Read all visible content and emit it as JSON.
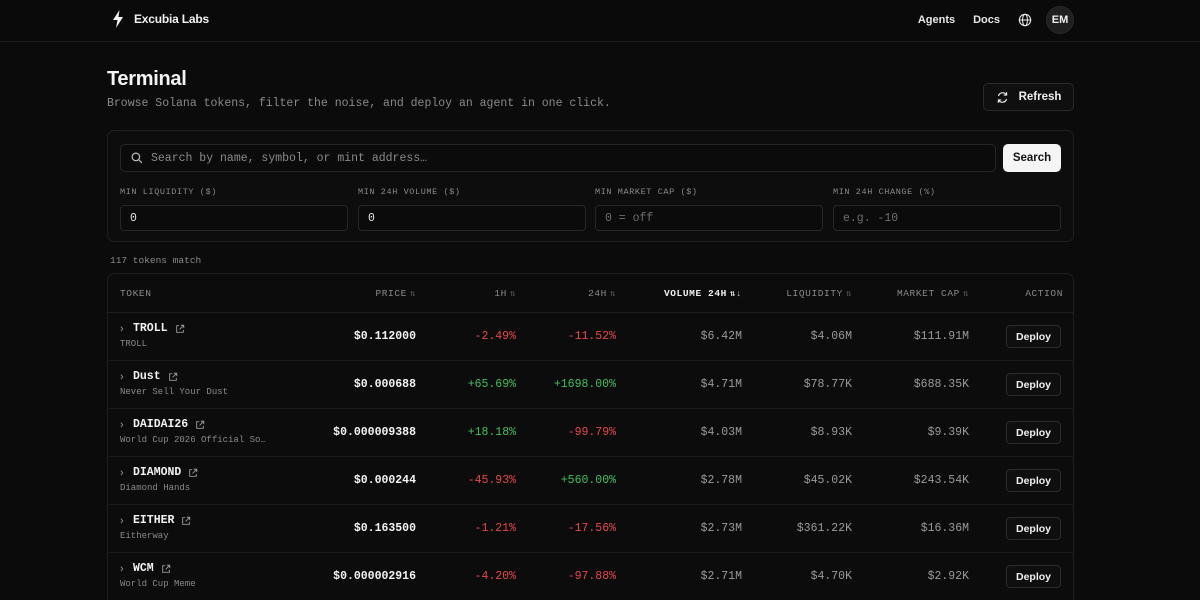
{
  "nav": {
    "brand": "Excubia Labs",
    "links": [
      "Agents",
      "Docs"
    ],
    "avatar_initials": "EM"
  },
  "header": {
    "title": "Terminal",
    "subtitle": "Browse Solana tokens, filter the noise, and deploy an agent in one click.",
    "refresh_label": "Refresh"
  },
  "filters": {
    "search_placeholder": "Search by name, symbol, or mint address…",
    "search_button": "Search",
    "fields": [
      {
        "label": "MIN LIQUIDITY ($)",
        "value": "0",
        "placeholder": ""
      },
      {
        "label": "MIN 24H VOLUME ($)",
        "value": "0",
        "placeholder": ""
      },
      {
        "label": "MIN MARKET CAP ($)",
        "value": "",
        "placeholder": "0 = off"
      },
      {
        "label": "MIN 24H CHANGE (%)",
        "value": "",
        "placeholder": "e.g. -10"
      }
    ]
  },
  "results": {
    "count_text": "117 tokens match"
  },
  "table": {
    "columns": {
      "token": "TOKEN",
      "price": "PRICE",
      "h1": "1H",
      "h24": "24H",
      "volume": "VOLUME 24H",
      "liquidity": "LIQUIDITY",
      "mcap": "MARKET CAP",
      "action": "ACTION"
    },
    "sorted_column": "volume",
    "rows": [
      {
        "symbol": "TROLL",
        "name": "TROLL",
        "price": "$0.112000",
        "h1": "-2.49%",
        "h24": "-11.52%",
        "volume": "$6.42M",
        "liquidity": "$4.06M",
        "mcap": "$111.91M",
        "action": "Deploy"
      },
      {
        "symbol": "Dust",
        "name": "Never Sell Your Dust",
        "price": "$0.000688",
        "h1": "+65.69%",
        "h24": "+1698.00%",
        "volume": "$4.71M",
        "liquidity": "$78.77K",
        "mcap": "$688.35K",
        "action": "Deploy"
      },
      {
        "symbol": "DAIDAI26",
        "name": "World Cup 2026 Official So…",
        "price": "$0.000009388",
        "h1": "+18.18%",
        "h24": "-99.79%",
        "volume": "$4.03M",
        "liquidity": "$8.93K",
        "mcap": "$9.39K",
        "action": "Deploy"
      },
      {
        "symbol": "DIAMOND",
        "name": "Diamond Hands",
        "price": "$0.000244",
        "h1": "-45.93%",
        "h24": "+560.00%",
        "volume": "$2.78M",
        "liquidity": "$45.02K",
        "mcap": "$243.54K",
        "action": "Deploy"
      },
      {
        "symbol": "EITHER",
        "name": "Eitherway",
        "price": "$0.163500",
        "h1": "-1.21%",
        "h24": "-17.56%",
        "volume": "$2.73M",
        "liquidity": "$361.22K",
        "mcap": "$16.36M",
        "action": "Deploy"
      },
      {
        "symbol": "WCM",
        "name": "World Cup Meme",
        "price": "$0.000002916",
        "h1": "-4.20%",
        "h24": "-97.88%",
        "volume": "$2.71M",
        "liquidity": "$4.70K",
        "mcap": "$2.92K",
        "action": "Deploy"
      }
    ]
  },
  "colors": {
    "positive": "#3fbf60",
    "negative": "#e5484d",
    "background": "#0b0b0b"
  },
  "icons": [
    "bolt-icon",
    "globe-icon",
    "refresh-icon",
    "search-icon",
    "chevron-right-icon",
    "external-link-icon",
    "sort-icon"
  ]
}
